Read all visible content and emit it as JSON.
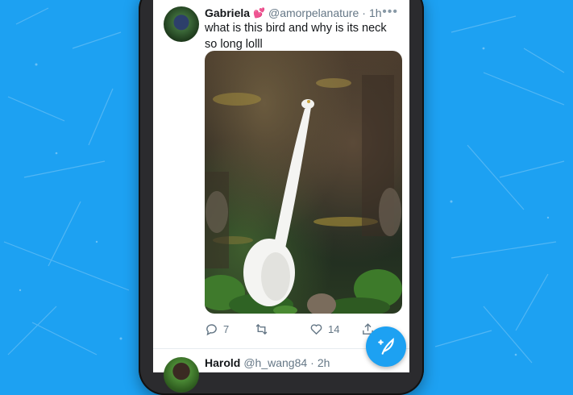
{
  "colors": {
    "brand_blue": "#1DA1F2",
    "text_primary": "#14171a",
    "text_secondary": "#657786"
  },
  "tweets": [
    {
      "name": "Gabriela",
      "name_emoji": "💕",
      "handle": "@amorpelanature",
      "separator": "·",
      "time": "1h",
      "text": "what is this bird and why is its neck so long lolll",
      "replies": "7",
      "likes": "14",
      "icons": {
        "reply": "reply-icon",
        "retweet": "retweet-icon",
        "like": "heart-icon",
        "share": "share-icon",
        "more": "more-icon"
      }
    },
    {
      "name": "Harold",
      "handle": "@h_wang84",
      "separator": "·",
      "time": "2h"
    }
  ],
  "compose_button": {
    "icon": "compose-tweet-icon"
  }
}
